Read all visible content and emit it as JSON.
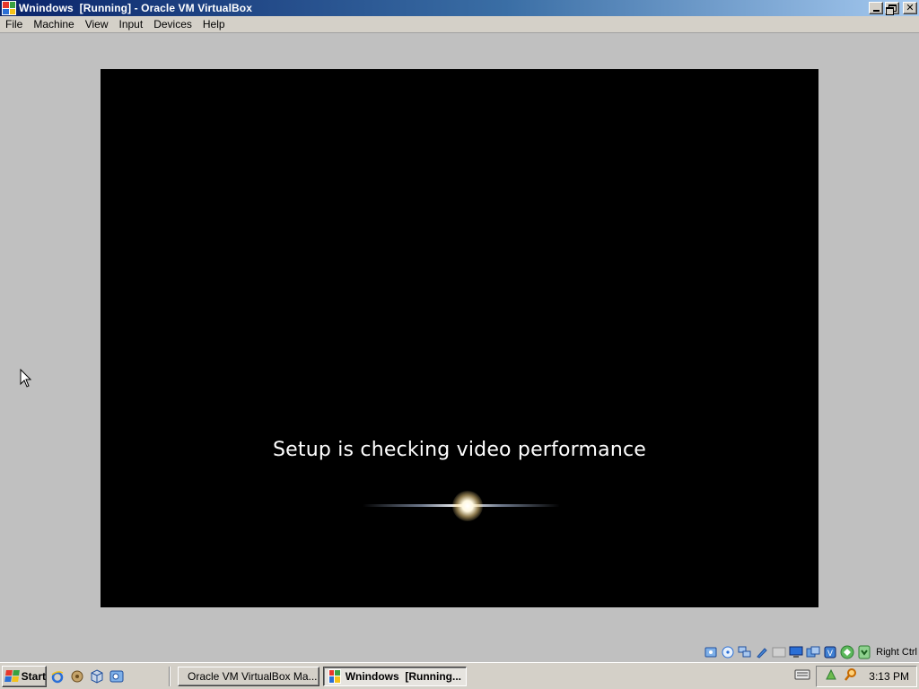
{
  "window": {
    "title": "Wnindows  [Running] - Oracle VM VirtualBox",
    "icon": "windows-flag-icon",
    "controls": [
      "minimize-icon",
      "restore-icon",
      "close-icon"
    ]
  },
  "menu": {
    "items": [
      "File",
      "Machine",
      "View",
      "Input",
      "Devices",
      "Help"
    ]
  },
  "vm": {
    "message": "Setup is checking video performance",
    "background_color": "#000000",
    "text_color": "#ffffff"
  },
  "status_bar": {
    "icons": [
      "hard-disk-icon",
      "optical-drive-icon",
      "network-icon",
      "usb-icon",
      "shared-folders-icon",
      "display-icon",
      "recording-icon",
      "vt-x-icon",
      "guest-additions-icon",
      "mouse-integration-icon",
      "keyboard-capture-icon"
    ],
    "host_key_label": "Right Ctrl"
  },
  "taskbar": {
    "start_label": "Start",
    "quick_launch": [
      "internet-explorer-icon",
      "network-tool-icon",
      "virtualbox-icon",
      "outlook-icon"
    ],
    "tasks": [
      {
        "label": "Oracle VM VirtualBox Ma...",
        "icon": "virtualbox-icon",
        "active": false
      },
      {
        "label": "Wnindows  [Running...",
        "icon": "windows-flag-icon",
        "active": true
      }
    ],
    "tray_icons": [
      "keyboard-icon",
      "recycle-icon",
      "search-icon"
    ],
    "clock": "3:13 PM"
  }
}
